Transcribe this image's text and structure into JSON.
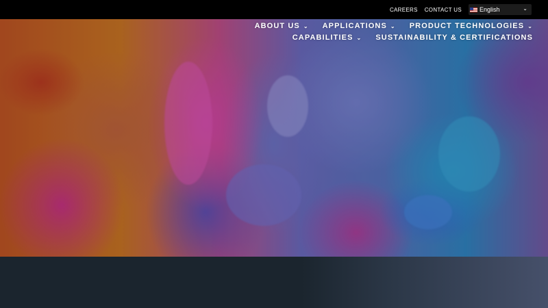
{
  "topbar": {
    "links": [
      "CAREERS",
      "CONTACT US"
    ],
    "language": {
      "flag": "us-flag-icon",
      "label": "English"
    }
  },
  "nav": {
    "items": [
      {
        "label": "ABOUT US",
        "has_dropdown": true
      },
      {
        "label": "APPLICATIONS",
        "has_dropdown": true
      },
      {
        "label": "PRODUCT TECHNOLOGIES",
        "has_dropdown": true
      },
      {
        "label": "CAPABILITIES",
        "has_dropdown": true
      },
      {
        "label": "SUSTAINABILITY & CERTIFICATIONS",
        "has_dropdown": false
      }
    ]
  },
  "colors": {
    "topbar_bg": "#000000",
    "band_dark": "#1b252e",
    "band_light": "#46506a"
  }
}
